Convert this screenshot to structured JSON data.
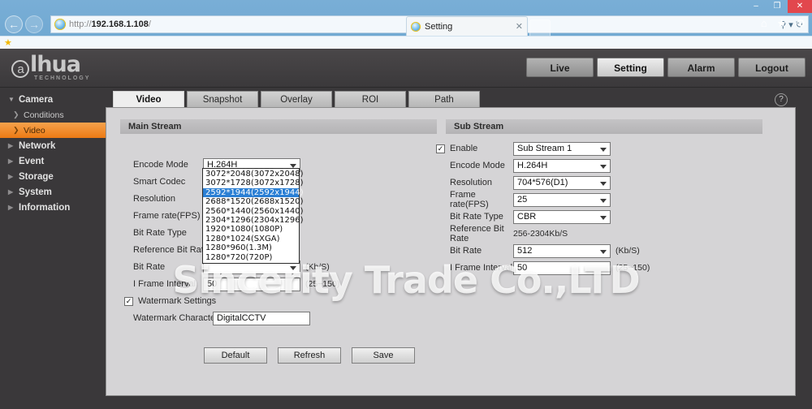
{
  "browser": {
    "window_controls": {
      "minimize": "–",
      "maximize": "❐",
      "close": "✕"
    },
    "back_label": "←",
    "forward_label": "→",
    "url": "http://192.168.1.108/",
    "url_scheme": "http://",
    "url_host": "192.168.1.108",
    "url_path": "/",
    "search_icon": "search-icon",
    "refresh_icon": "refresh-icon",
    "tab": {
      "title": "Setting",
      "close_label": "✕"
    },
    "chrome_icons": [
      "home-icon",
      "favorites-star-icon",
      "tools-gear-icon"
    ],
    "favorites_bar_star": "★"
  },
  "page_header": {
    "logo_text": "alhua",
    "logo_mark": "a",
    "logo_word": "lhua",
    "logo_subtitle": "TECHNOLOGY",
    "nav": [
      {
        "label": "Live",
        "active": false
      },
      {
        "label": "Setting",
        "active": true
      },
      {
        "label": "Alarm",
        "active": false
      },
      {
        "label": "Logout",
        "active": false
      }
    ]
  },
  "sidebar": {
    "items": [
      {
        "label": "Camera",
        "type": "group",
        "expanded": true,
        "arrow": "▼"
      },
      {
        "label": "Conditions",
        "type": "child",
        "active": false,
        "arrow": "❯"
      },
      {
        "label": "Video",
        "type": "child",
        "active": true,
        "arrow": "❯"
      },
      {
        "label": "Network",
        "type": "group",
        "expanded": false,
        "arrow": "▶"
      },
      {
        "label": "Event",
        "type": "group",
        "expanded": false,
        "arrow": "▶"
      },
      {
        "label": "Storage",
        "type": "group",
        "expanded": false,
        "arrow": "▶"
      },
      {
        "label": "System",
        "type": "group",
        "expanded": false,
        "arrow": "▶"
      },
      {
        "label": "Information",
        "type": "group",
        "expanded": false,
        "arrow": "▶"
      }
    ]
  },
  "content": {
    "tabs": [
      {
        "label": "Video",
        "active": true
      },
      {
        "label": "Snapshot",
        "active": false
      },
      {
        "label": "Overlay",
        "active": false
      },
      {
        "label": "ROI",
        "active": false
      },
      {
        "label": "Path",
        "active": false
      }
    ],
    "help_icon_label": "?",
    "main_stream": {
      "heading": "Main Stream",
      "encode_mode": {
        "label": "Encode Mode",
        "value": "H.264H"
      },
      "smart_codec": {
        "label": "Smart Codec"
      },
      "resolution": {
        "label": "Resolution",
        "value": "2592*1944(2592x1944)"
      },
      "frame_rate": {
        "label": "Frame rate(FPS)"
      },
      "bit_rate_type": {
        "label": "Bit Rate Type"
      },
      "reference_bit_rate": {
        "label": "Reference Bit Rate"
      },
      "bit_rate": {
        "label": "Bit Rate",
        "unit": "(Kb/S)"
      },
      "i_frame_interval": {
        "label": "I Frame Interval",
        "value": "50",
        "hint": "(25~150)"
      },
      "watermark_settings": {
        "label": "Watermark Settings",
        "checked": true,
        "check_glyph": "✓"
      },
      "watermark_character": {
        "label": "Watermark Character",
        "value": "DigitalCCTV"
      }
    },
    "resolution_dropdown": {
      "open": true,
      "options": [
        "3072*2048(3072x2048)",
        "3072*1728(3072x1728)",
        "2592*1944(2592x1944)",
        "2688*1520(2688x1520)",
        "2560*1440(2560x1440)",
        "2304*1296(2304x1296)",
        "1920*1080(1080P)",
        "1280*1024(SXGA)",
        "1280*960(1.3M)",
        "1280*720(720P)"
      ],
      "selected_index": 2
    },
    "sub_stream": {
      "heading": "Sub Stream",
      "enable": {
        "label": "Enable",
        "checked": true,
        "check_glyph": "✓",
        "value": "Sub Stream 1"
      },
      "encode_mode": {
        "label": "Encode Mode",
        "value": "H.264H"
      },
      "resolution": {
        "label": "Resolution",
        "value": "704*576(D1)"
      },
      "frame_rate": {
        "label": "Frame rate(FPS)",
        "value": "25"
      },
      "bit_rate_type": {
        "label": "Bit Rate Type",
        "value": "CBR"
      },
      "reference_bit_rate": {
        "label": "Reference Bit Rate",
        "value": "256-2304Kb/S"
      },
      "bit_rate": {
        "label": "Bit Rate",
        "value": "512",
        "unit": "(Kb/S)"
      },
      "i_frame_interval": {
        "label": "I Frame Interval",
        "value": "50",
        "hint": "(25~150)"
      }
    },
    "buttons": [
      {
        "label": "Default"
      },
      {
        "label": "Refresh"
      },
      {
        "label": "Save"
      }
    ]
  },
  "overlay": {
    "watermark_text": "Sincerity Trade Co.,LTD"
  },
  "colors": {
    "accent_orange": "#ec7a14",
    "panel_gray": "#d5d4d6",
    "chrome_blue": "#6ba3d0",
    "select_blue": "#2a7fd4",
    "close_red": "#e2474d"
  }
}
